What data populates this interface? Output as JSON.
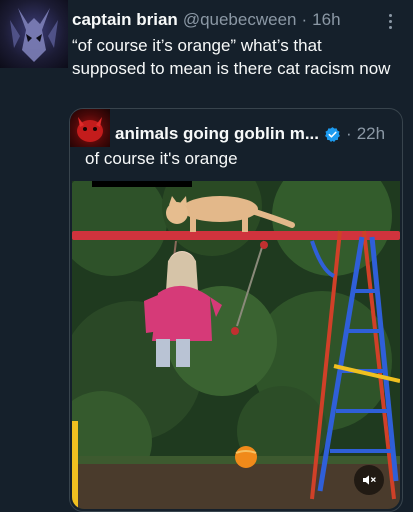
{
  "tweet": {
    "author_name": "captain brian",
    "handle": "@quebecween",
    "separator": "·",
    "time": "16h",
    "text": "“of course it’s orange” what’s that supposed to mean is there cat racism now",
    "avatar_icon": "demon-mask-avatar",
    "more_icon": "more-options-icon"
  },
  "quoted": {
    "author_name": "animals going goblin m...",
    "separator": "·",
    "time": "22h",
    "verified_icon": "verified-badge-icon",
    "text": "of course it's orange",
    "media": {
      "type": "video",
      "mute_icon": "volume-muted-icon"
    }
  },
  "colors": {
    "background": "#15202b",
    "text": "#f7f9f9",
    "secondary_text": "#8b98a5",
    "border": "#38444d",
    "verified": "#1d9bf0"
  }
}
